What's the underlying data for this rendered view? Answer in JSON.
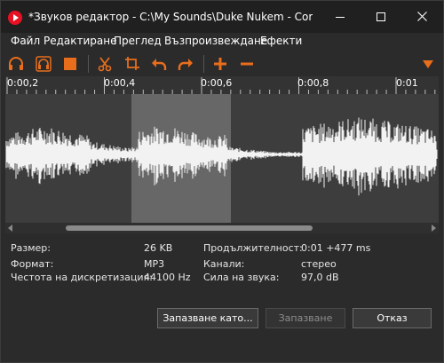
{
  "window": {
    "title": "*Звуков редактор - C:\\My Sounds\\Duke Nukem - Come g...",
    "accent": "#e86e1c"
  },
  "menu": {
    "items": [
      "Файл",
      "Редактиране",
      "Преглед",
      "Възпроизвеждане",
      "Ефекти"
    ]
  },
  "toolbar": {
    "icons": [
      "headphones-icon",
      "headphones-selection-icon",
      "stop-icon",
      "cut-icon",
      "crop-icon",
      "undo-icon",
      "redo-icon",
      "add-icon",
      "remove-icon",
      "dropdown-arrow-icon"
    ]
  },
  "timeline": {
    "labels": [
      "0:00,2",
      "0:00,4",
      "0:00,6",
      "0:00,8",
      "0:01"
    ]
  },
  "selection": {
    "start_fraction": 0.29,
    "end_fraction": 0.52
  },
  "scroll": {
    "thumb_start_fraction": 0.14,
    "thumb_size_fraction": 0.57
  },
  "info": {
    "size_label": "Размер:",
    "size_value": "26 KB",
    "format_label": "Формат:",
    "format_value": "MP3",
    "rate_label": "Честота на дискретизация:",
    "rate_value": "44100 Hz",
    "duration_label": "Продължителност:",
    "duration_value": "0:01 +477 ms",
    "channels_label": "Канали:",
    "channels_value": "стерео",
    "volume_label": "Сила на звука:",
    "volume_value": "97,0 dB"
  },
  "buttons": {
    "save_as": "Запазване като...",
    "save": "Запазване",
    "cancel": "Отказ"
  }
}
